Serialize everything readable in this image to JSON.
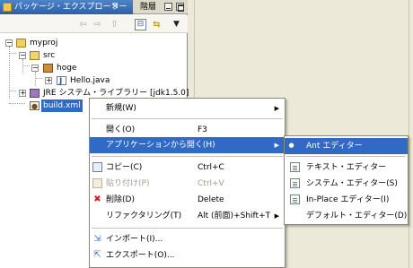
{
  "view": {
    "active_tab": "パッケージ・エクスプローラー",
    "close_glyph": "✕",
    "other_tab": "階層"
  },
  "toolbar": {
    "back_icon": "⇦",
    "forward_icon": "⇨",
    "up_icon": "⇧",
    "collapse_icon": "⊟",
    "link_icon": "⇆",
    "menu_icon": "▼"
  },
  "tree": {
    "expand_minus": "−",
    "expand_plus": "+",
    "items": [
      {
        "label": "myproj"
      },
      {
        "label": "src"
      },
      {
        "label": "hoge"
      },
      {
        "label": "Hello.java"
      },
      {
        "label": "JRE システム・ライブラリー [jdk1.5.0]"
      },
      {
        "label": "build.xml"
      }
    ]
  },
  "context_menu": {
    "items": [
      {
        "label": "新規(W)",
        "arrow": "▶"
      },
      {
        "label": "開く(O)",
        "shortcut": "F3"
      },
      {
        "label": "アプリケーションから開く(H)",
        "arrow": "▶"
      },
      {
        "label": "コピー(C)",
        "shortcut": "Ctrl+C"
      },
      {
        "label": "貼り付け(P)",
        "shortcut": "Ctrl+V"
      },
      {
        "label": "削除(D)",
        "shortcut": "Delete"
      },
      {
        "label": "リファクタリング(T)",
        "shortcut": "Alt (前面)+Shift+T",
        "arrow": "▶"
      },
      {
        "label": "インポート(I)..."
      },
      {
        "label": "エクスポート(O)..."
      }
    ]
  },
  "submenu": {
    "items": [
      {
        "label": "Ant エディター",
        "icon": "ant-editor-icon"
      },
      {
        "label": "テキスト・エディター",
        "icon": "text-editor-icon"
      },
      {
        "label": "システム・エディター(S)",
        "icon": "system-editor-icon"
      },
      {
        "label": "In-Place エディター(I)",
        "icon": "inplace-editor-icon"
      },
      {
        "label": "デフォルト・エディター(D)"
      }
    ],
    "bullet": "●"
  },
  "colors": {
    "selection": "#316ac5",
    "tab_active": "#2c5fa8"
  }
}
